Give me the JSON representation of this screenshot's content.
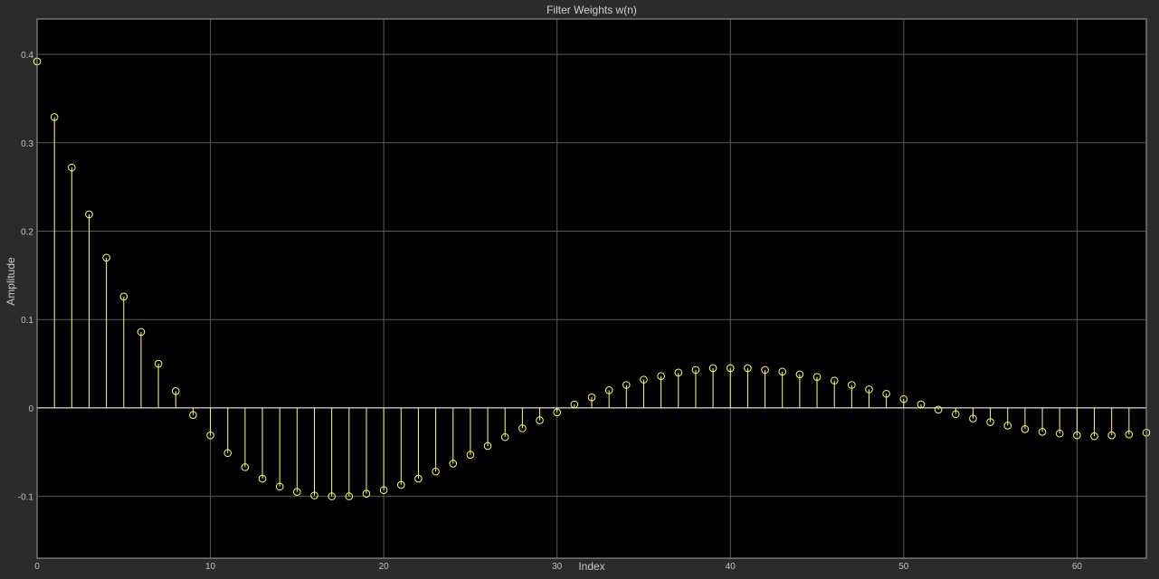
{
  "colors": {
    "figure_background": "#2b2b2b",
    "axes_background": "#000000",
    "grid": "#5a5a5a",
    "axes_border": "#a0a0a0",
    "stem": "#ffff66",
    "text": "#c8c8c8"
  },
  "chart_data": {
    "type": "stem",
    "title": "Filter Weights w(n)",
    "xlabel": "Index",
    "ylabel": "Amplitude",
    "xlim": [
      0,
      64
    ],
    "ylim": [
      -0.17,
      0.44
    ],
    "grid": true,
    "marker": "circle",
    "xticks": [
      0,
      10,
      20,
      30,
      40,
      50,
      60
    ],
    "xtick_labels": [
      "0",
      "10",
      "20",
      "30",
      "40",
      "50",
      "60"
    ],
    "yticks": [
      -0.1,
      0,
      0.1,
      0.2,
      0.3,
      0.4
    ],
    "ytick_labels": [
      "-0.1",
      "0",
      "0.1",
      "0.2",
      "0.3",
      "0.4"
    ],
    "x": [
      0,
      1,
      2,
      3,
      4,
      5,
      6,
      7,
      8,
      9,
      10,
      11,
      12,
      13,
      14,
      15,
      16,
      17,
      18,
      19,
      20,
      21,
      22,
      23,
      24,
      25,
      26,
      27,
      28,
      29,
      30,
      31,
      32,
      33,
      34,
      35,
      36,
      37,
      38,
      39,
      40,
      41,
      42,
      43,
      44,
      45,
      46,
      47,
      48,
      49,
      50,
      51,
      52,
      53,
      54,
      55,
      56,
      57,
      58,
      59,
      60,
      61,
      62,
      63,
      64
    ],
    "y": [
      0.392,
      0.329,
      0.272,
      0.219,
      0.17,
      0.126,
      0.086,
      0.05,
      0.019,
      -0.008,
      -0.031,
      -0.051,
      -0.067,
      -0.08,
      -0.089,
      -0.095,
      -0.099,
      -0.1,
      -0.1,
      -0.097,
      -0.093,
      -0.087,
      -0.08,
      -0.072,
      -0.063,
      -0.053,
      -0.043,
      -0.033,
      -0.023,
      -0.014,
      -0.005,
      0.004,
      0.012,
      0.02,
      0.026,
      0.032,
      0.036,
      0.04,
      0.043,
      0.045,
      0.045,
      0.045,
      0.043,
      0.041,
      0.038,
      0.035,
      0.031,
      0.026,
      0.021,
      0.016,
      0.01,
      0.004,
      -0.002,
      -0.007,
      -0.012,
      -0.016,
      -0.02,
      -0.024,
      -0.027,
      -0.029,
      -0.031,
      -0.032,
      -0.031,
      -0.03,
      -0.028
    ]
  }
}
